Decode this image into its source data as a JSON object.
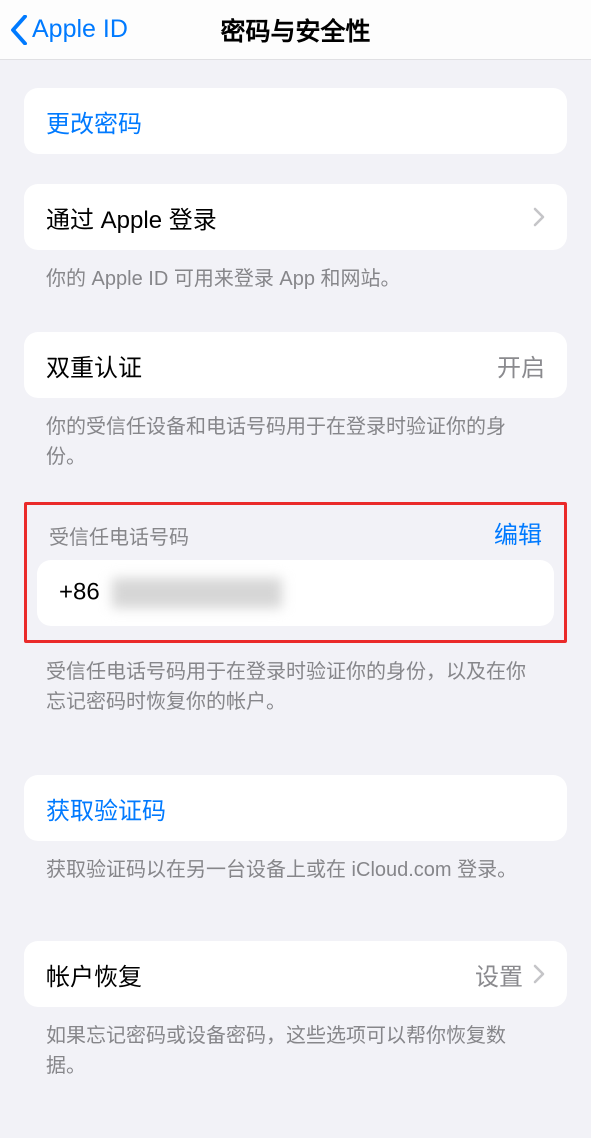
{
  "header": {
    "back_label": "Apple ID",
    "title": "密码与安全性"
  },
  "change_password_label": "更改密码",
  "sign_in_with_apple": {
    "label": "通过 Apple 登录",
    "footer": "你的 Apple ID 可用来登录 App 和网站。"
  },
  "two_factor": {
    "label": "双重认证",
    "value": "开启",
    "footer": "你的受信任设备和电话号码用于在登录时验证你的身份。"
  },
  "trusted_phone": {
    "header": "受信任电话号码",
    "edit": "编辑",
    "number_prefix": "+86",
    "footer": "受信任电话号码用于在登录时验证你的身份，以及在你忘记密码时恢复你的帐户。"
  },
  "get_code": {
    "label": "获取验证码",
    "footer": "获取验证码以在另一台设备上或在 iCloud.com 登录。"
  },
  "account_recovery": {
    "label": "帐户恢复",
    "value": "设置",
    "footer": "如果忘记密码或设备密码，这些选项可以帮你恢复数据。"
  }
}
